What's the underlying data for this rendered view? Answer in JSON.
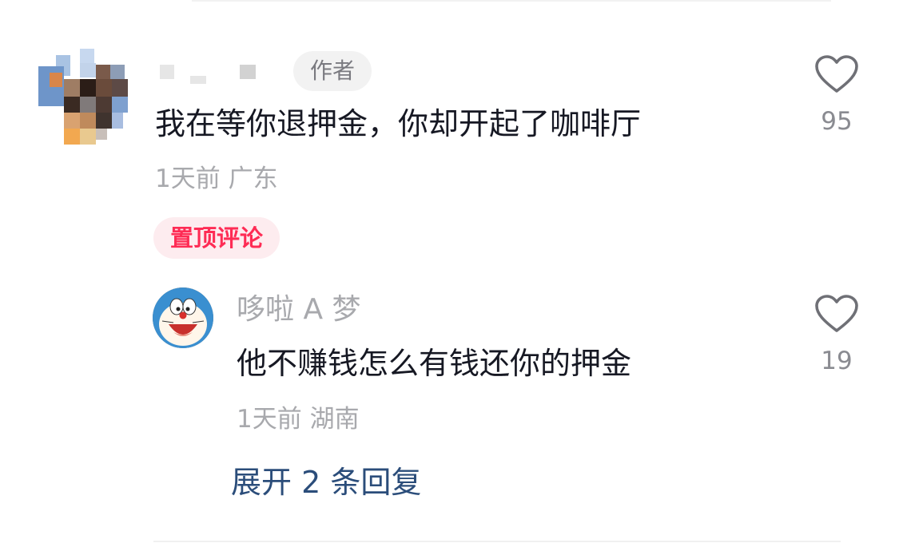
{
  "main_comment": {
    "author_badge": "作者",
    "text": "我在等你退押金，你却开起了咖啡厅",
    "time": "1天前",
    "location": "广东",
    "pinned_label": "置顶评论",
    "likes": "95",
    "avatar_icon": "pixelated-avatar-icon",
    "like_icon": "heart-outline-icon"
  },
  "reply": {
    "username": "哆啦 A 梦",
    "text": "他不赚钱怎么有钱还你的押金",
    "time": "1天前",
    "location": "湖南",
    "likes": "19",
    "avatar_icon": "doraemon-avatar-icon",
    "like_icon": "heart-outline-icon"
  },
  "expand": {
    "label": "展开 2 条回复",
    "color": "#2b4d7a"
  },
  "colors": {
    "pinned_text": "#fe2c55",
    "pinned_bg": "#fdecef",
    "meta_text": "#a8a9ad",
    "body_text": "#161823"
  }
}
